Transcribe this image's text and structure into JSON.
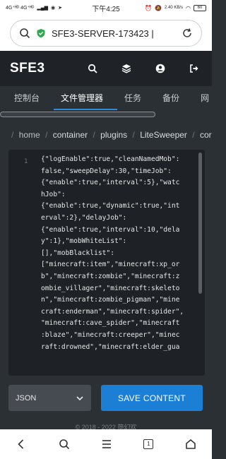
{
  "status_bar": {
    "network_left": "4G⁺ᴴᴰ 4G⁺ᴴᴰ",
    "time": "下午4:25",
    "speed": "2.40 KB/s",
    "battery": "60"
  },
  "browser": {
    "url": "SFE3-SERVER-173423 |"
  },
  "app": {
    "brand": "SFE3"
  },
  "tabs": [
    {
      "label": "控制台"
    },
    {
      "label": "文件管理器"
    },
    {
      "label": "任务"
    },
    {
      "label": "备份"
    },
    {
      "label": "网"
    }
  ],
  "breadcrumb": [
    "home",
    "container",
    "plugins",
    "LiteSweeper",
    "cor"
  ],
  "editor": {
    "line_number": "1",
    "lines": [
      "{\"logEnable\":true,\"cleanNamedMob\":",
      "false,\"sweepDelay\":30,\"timeJob\":",
      "{\"enable\":true,\"interval\":5},\"watc",
      "hJob\":",
      "{\"enable\":true,\"dynamic\":true,\"int",
      "erval\":2},\"delayJob\":",
      "{\"enable\":true,\"interval\":10,\"dela",
      "y\":1},\"mobWhiteList\":",
      "[],\"mobBlacklist\":",
      "[\"minecraft:item\",\"minecraft:xp_or",
      "b\",\"minecraft:zombie\",\"minecraft:z",
      "ombie_villager\",\"minecraft:skeleto",
      "n\",\"minecraft:zombie_pigman\",\"mine",
      "craft:enderman\",\"minecraft:spider\",",
      "\"minecraft:cave_spider\",\"minecraft",
      ":blaze\",\"minecraft:creeper\",\"minec",
      "raft:drowned\",\"minecraft:elder_gua"
    ]
  },
  "controls": {
    "format_select": "JSON",
    "save_label": "SAVE CONTENT"
  },
  "footer": {
    "copyright": "© 2018 - 2022 简幻欢"
  },
  "nav": {
    "tab_count": "1"
  }
}
